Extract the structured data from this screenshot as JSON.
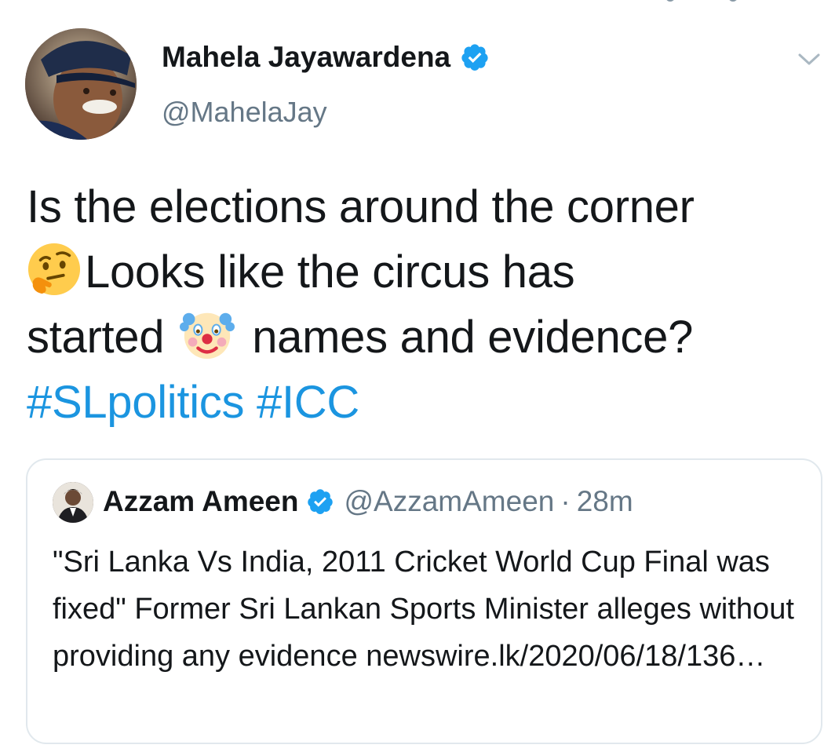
{
  "tweet": {
    "author": {
      "display_name": "Mahela Jayawardena",
      "handle": "@MahelaJay",
      "verified": true,
      "avatar_icon": "profile-photo"
    },
    "text_parts": {
      "line1": "Is the elections around the corner",
      "emoji1": "thinking-face",
      "line2": "Looks like the circus has",
      "line3a": "started",
      "emoji2": "clown-face",
      "line3b": "names and evidence?",
      "hashtag1": "#SLpolitics",
      "hashtag2": "#ICC"
    },
    "menu_icon": "chevron-down-icon"
  },
  "quoted_tweet": {
    "author": {
      "display_name": "Azzam Ameen",
      "handle": "@AzzamAmeen",
      "separator": "·",
      "time": "28m",
      "verified": true
    },
    "text": "\"Sri Lanka Vs India, 2011 Cricket World Cup Final was fixed\" Former Sri Lankan Sports Minister alleges without providing any evidence newswire.lk/2020/06/18/136…"
  },
  "colors": {
    "text_primary": "#14171a",
    "text_secondary": "#657786",
    "link": "#1b95e0",
    "verified": "#1da1f2",
    "border": "#e1e8ed"
  }
}
